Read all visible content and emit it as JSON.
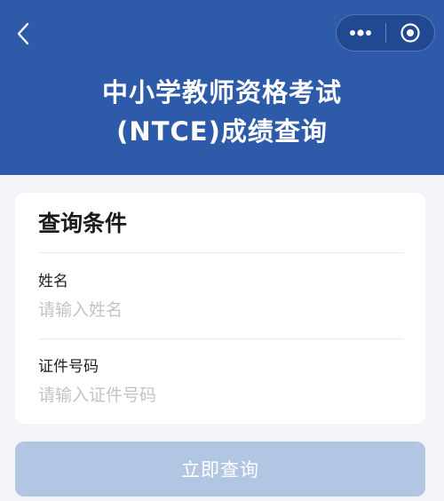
{
  "header": {
    "title_line1": "中小学教师资格考试",
    "title_line2": "(NTCE)成绩查询",
    "back_icon": "chevron-left-icon",
    "more_icon": "more-dots-icon",
    "close_icon": "target-circle-icon"
  },
  "form": {
    "card_title": "查询条件",
    "name_label": "姓名",
    "name_placeholder": "请输入姓名",
    "name_value": "",
    "id_label": "证件号码",
    "id_placeholder": "请输入证件号码",
    "id_value": ""
  },
  "submit": {
    "label": "立即查询"
  },
  "colors": {
    "header_bg": "#2d5ba9",
    "button_disabled": "#b0c6e2",
    "page_bg": "#f3f4f8"
  }
}
